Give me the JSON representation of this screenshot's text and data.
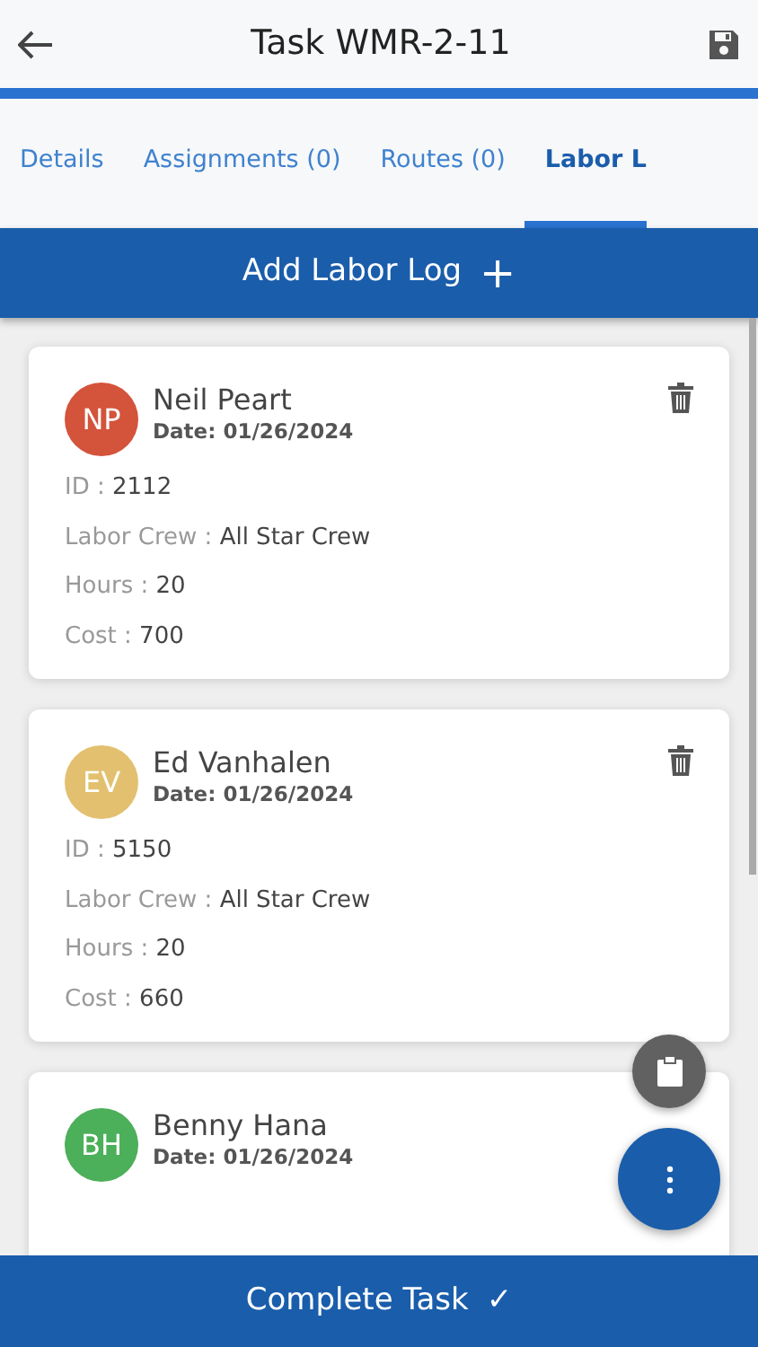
{
  "header": {
    "title": "Task WMR-2-11"
  },
  "tabs": [
    {
      "label": "Details",
      "selected": false
    },
    {
      "label": "Assignments (0)",
      "selected": false
    },
    {
      "label": "Routes (0)",
      "selected": false
    },
    {
      "label": "Labor L",
      "selected": true
    }
  ],
  "add_button": {
    "label": "Add Labor Log",
    "icon": "+"
  },
  "labor_logs": [
    {
      "initials": "NP",
      "color": "#d4533b",
      "name": "Neil Peart",
      "date": "Date: 01/26/2024",
      "fields": [
        {
          "label": "ID :",
          "value": "2112"
        },
        {
          "label": "Labor Crew :",
          "value": "All Star Crew"
        },
        {
          "label": "Hours :",
          "value": "20"
        },
        {
          "label": "Cost :",
          "value": "700"
        }
      ],
      "deletable": true
    },
    {
      "initials": "EV",
      "color": "#e2c06f",
      "name": "Ed Vanhalen",
      "date": "Date: 01/26/2024",
      "fields": [
        {
          "label": "ID :",
          "value": "5150"
        },
        {
          "label": "Labor Crew :",
          "value": "All Star Crew"
        },
        {
          "label": "Hours :",
          "value": "20"
        },
        {
          "label": "Cost :",
          "value": "660"
        }
      ],
      "deletable": true
    },
    {
      "initials": "BH",
      "color": "#4caf5a",
      "name": "Benny Hana",
      "date": "Date: 01/26/2024",
      "deletable": false
    }
  ],
  "complete_button": {
    "label": "Complete Task",
    "icon": "✓"
  }
}
